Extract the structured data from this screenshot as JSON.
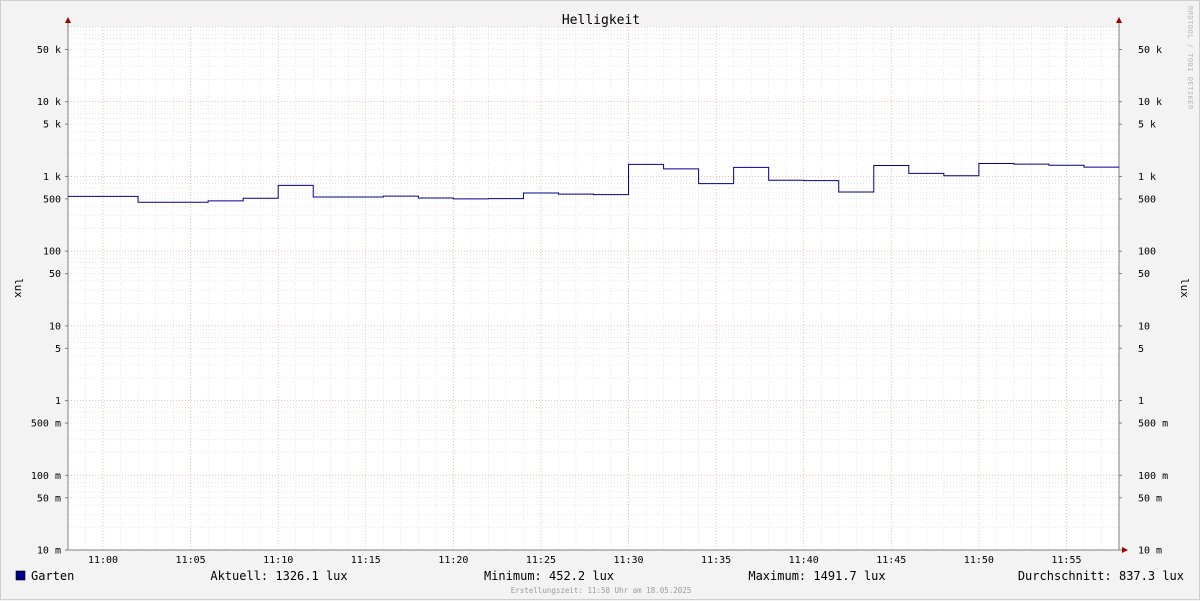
{
  "colors": {
    "background": "#f3f3f3",
    "plot_background": "#ffffff",
    "series": "#00008b",
    "minor_grid": "#d0d0d0",
    "major_grid": "#e8a0a0",
    "axis": "#808080",
    "arrow": "#a00000"
  },
  "watermark": "RRDTOOL / TOBI OETIKER",
  "footer": "Erstellungszeit: 11:58 Uhr am 18.05.2025",
  "chart_data": {
    "type": "line",
    "title": "Helligkeit",
    "ylabel": "lux",
    "ylabel_right": "lux",
    "y_scale": "log",
    "ylim": [
      0.01,
      100000
    ],
    "xlim": [
      "10:58",
      "11:58"
    ],
    "y_ticks": [
      {
        "value": 50000,
        "label": "50 k"
      },
      {
        "value": 10000,
        "label": "10 k"
      },
      {
        "value": 5000,
        "label": "5 k"
      },
      {
        "value": 1000,
        "label": "1 k"
      },
      {
        "value": 500,
        "label": "500"
      },
      {
        "value": 100,
        "label": "100"
      },
      {
        "value": 50,
        "label": "50"
      },
      {
        "value": 10,
        "label": "10"
      },
      {
        "value": 5,
        "label": "5"
      },
      {
        "value": 1,
        "label": "1"
      },
      {
        "value": 0.5,
        "label": "500 m"
      },
      {
        "value": 0.1,
        "label": "100 m"
      },
      {
        "value": 0.05,
        "label": "50 m"
      },
      {
        "value": 0.01,
        "label": "10 m"
      }
    ],
    "x_ticks": [
      "11:00",
      "11:05",
      "11:10",
      "11:15",
      "11:20",
      "11:25",
      "11:30",
      "11:35",
      "11:40",
      "11:45",
      "11:50",
      "11:55"
    ],
    "grid": true,
    "series": [
      {
        "name": "Garten",
        "color": "#00008b",
        "x": [
          "10:58",
          "11:00",
          "11:02",
          "11:04",
          "11:06",
          "11:08",
          "11:10",
          "11:12",
          "11:14",
          "11:16",
          "11:18",
          "11:20",
          "11:22",
          "11:24",
          "11:26",
          "11:28",
          "11:30",
          "11:32",
          "11:34",
          "11:36",
          "11:38",
          "11:40",
          "11:42",
          "11:44",
          "11:46",
          "11:48",
          "11:50",
          "11:52",
          "11:54",
          "11:56",
          "11:58"
        ],
        "values": [
          540,
          540,
          452,
          452,
          470,
          510,
          760,
          530,
          530,
          545,
          515,
          500,
          505,
          600,
          580,
          570,
          1450,
          1260,
          800,
          1320,
          890,
          880,
          620,
          1400,
          1100,
          1020,
          1490,
          1460,
          1410,
          1330,
          1326
        ]
      }
    ]
  },
  "legend": {
    "series_name": "Garten",
    "current": "Aktuell: 1326.1 lux",
    "minimum": "Minimum: 452.2 lux",
    "maximum": "Maximum: 1491.7 lux",
    "average": "Durchschnitt: 837.3 lux"
  }
}
